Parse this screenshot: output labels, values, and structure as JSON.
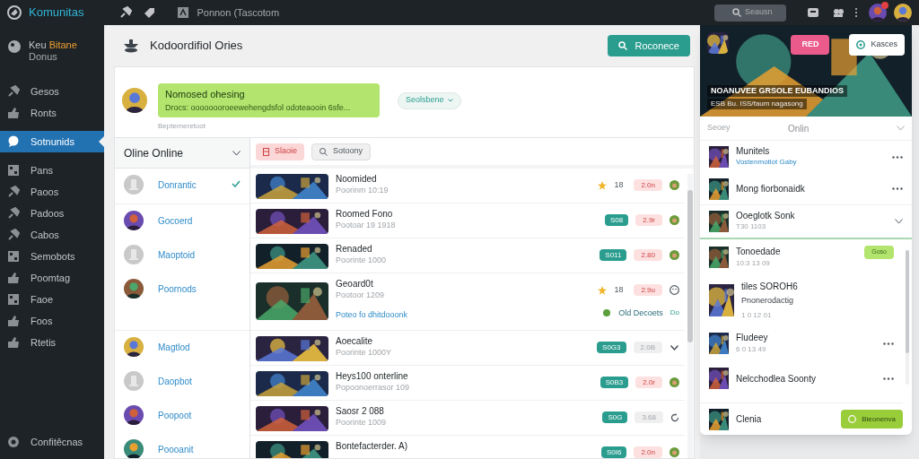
{
  "topbar": {
    "brand": "Komunitas",
    "site": "Ponnon (Tascotom",
    "search_placeholder": "Seausn"
  },
  "sidebar": {
    "site": {
      "label": "Keu",
      "highlight": "Bitane",
      "sub": "Donus"
    },
    "items": [
      {
        "label": "Gesos",
        "selected": false
      },
      {
        "label": "Ronts",
        "selected": false
      },
      {
        "label": "Sotnunids",
        "selected": true
      },
      {
        "label": "Pans",
        "selected": false
      },
      {
        "label": "Paoos",
        "selected": false
      },
      {
        "label": "Padoos",
        "selected": false
      },
      {
        "label": "Cabos",
        "selected": false
      },
      {
        "label": "Semobots",
        "selected": false
      },
      {
        "label": "Poomtag",
        "selected": false
      },
      {
        "label": "Faoe",
        "selected": false
      },
      {
        "label": "Foos",
        "selected": false
      },
      {
        "label": "Rtetis",
        "selected": false
      }
    ],
    "footer": "Confitêcnas"
  },
  "main": {
    "title": "Kodoordifiol Ories",
    "action": "Roconece",
    "notice": {
      "title": "Nomosed ohesing",
      "text": "Drocs: oooooooroeewehengdsfol odoteaooin 6sfe...",
      "dropdown": "Seolsbene",
      "caption": "Bepterneretoot"
    },
    "users_header": "Oline Online",
    "users": [
      {
        "name": "Donrantic",
        "kind": "placeholder",
        "selected": true
      },
      {
        "name": "Gocoerd",
        "selected": false
      },
      {
        "name": "Maoptoid",
        "kind": "placeholder",
        "selected": false
      },
      {
        "name": "Poornods",
        "selected": false
      },
      {
        "name": "Magtlod",
        "selected": false
      },
      {
        "name": "Daopbot",
        "kind": "placeholder",
        "selected": false
      },
      {
        "name": "Poopoot",
        "selected": false
      },
      {
        "name": "Poooanit",
        "selected": false
      }
    ],
    "filters": [
      {
        "label": "Slaoie",
        "kind": "danger"
      },
      {
        "label": "Sotoony",
        "kind": "search"
      }
    ],
    "rows": [
      {
        "title": "Noomided",
        "sub": "Poorinm 10:19",
        "rating": "18",
        "score": {
          "text": "2.0n",
          "kind": "alert"
        },
        "trailing": {
          "kind": "avatar"
        }
      },
      {
        "title": "Roomed Fono",
        "sub": "Pootoar 19 1918",
        "tag": "S08",
        "score": {
          "text": "2.9r",
          "kind": "alert"
        },
        "trailing": {
          "kind": "avatar"
        }
      },
      {
        "title": "Renaded",
        "sub": "Poorinte 1000",
        "tag": "S011",
        "score": {
          "text": "2.80",
          "kind": "alert"
        },
        "trailing": {
          "kind": "avatar"
        }
      },
      {
        "title": "Geoard0t",
        "sub": "Pootoor 1209",
        "link": "Poteo fo dhitdooonk",
        "rating": "18",
        "score": {
          "text": "2.9u",
          "kind": "alert"
        },
        "trailing": {
          "kind": "face"
        },
        "note": "Old Decoets",
        "note_end": "Do"
      },
      {
        "title": "Aoecalite",
        "sub": "Poorinte 1000Y",
        "tag": "S0G3",
        "score": {
          "text": "2.0B",
          "kind": "neutral"
        },
        "trailing": {
          "kind": "chevron"
        }
      },
      {
        "title": "Heys100 onterline",
        "sub": "Popoonoerrasor 109",
        "tag": "S0B3",
        "score": {
          "text": "2.0r",
          "kind": "alert"
        },
        "trailing": {
          "kind": "avatar"
        }
      },
      {
        "title": "Saosr 2 088",
        "sub": "Poorinte 1009",
        "tag": "S0G",
        "score": {
          "text": "3.68",
          "kind": "neutral"
        },
        "trailing": {
          "kind": "refresh"
        }
      },
      {
        "title": "Bontefacterder. A)",
        "tag": "S0I6",
        "score": {
          "text": "2.0n",
          "kind": "alert"
        },
        "trailing": {
          "kind": "avatar"
        }
      }
    ]
  },
  "panel": {
    "banner": {
      "badge": "RED",
      "button": "Kasces",
      "headline": "NOANUVEE GRSOLE EUBANDIOS",
      "sub": "ESB Bu. ISS/faum nagasong"
    },
    "header": {
      "left": "Seoey",
      "center": "Onlin"
    },
    "top_items": [
      {
        "title": "Munitels",
        "sub": "Vostenmotlot Gaby",
        "trailing": {
          "kind": "more"
        }
      },
      {
        "title": "Mong fiorbonaidk",
        "trailing": {
          "kind": "more"
        }
      },
      {
        "title": "Ooeglotk Sonk",
        "sub": "T30 1103",
        "trailing": {
          "kind": "chevron"
        }
      }
    ],
    "items": [
      {
        "title": "Tonoedade",
        "sub": "10:3 13 09",
        "pill": "Goso"
      },
      {
        "title": "tiles SOROH6",
        "sub": "Pnonerodactig",
        "sub2": "1 0 12 01"
      },
      {
        "title": "Fludeey",
        "sub": "6 0 13 49",
        "trailing": {
          "kind": "more"
        }
      },
      {
        "title": "Nelcchodlea Soonty",
        "trailing": {
          "kind": "more"
        }
      },
      {
        "title": "Clenia",
        "button": "Bieonenva"
      }
    ]
  }
}
